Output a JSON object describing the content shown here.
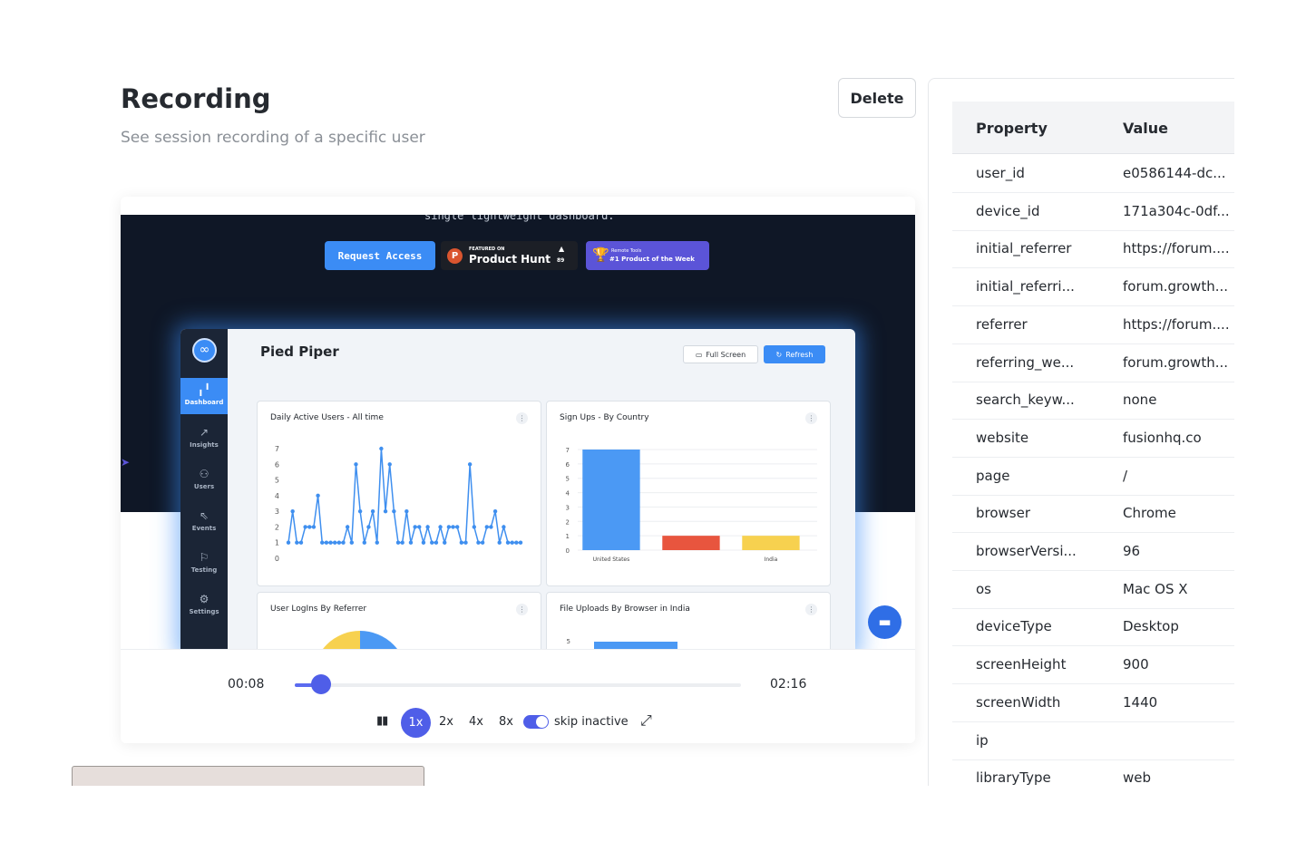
{
  "header": {
    "title": "Recording",
    "subtitle": "See session recording of a specific user",
    "delete_label": "Delete"
  },
  "recording": {
    "hero_text": "single lightweight dashboard.",
    "request_access_label": "Request Access",
    "product_hunt": {
      "featured": "FEATURED ON",
      "name": "Product Hunt",
      "upvotes": "89"
    },
    "remote_tools": {
      "small": "Remote Tools",
      "big": "#1 Product of the Week"
    },
    "dashboard": {
      "title": "Pied Piper",
      "full_screen_label": "Full Screen",
      "refresh_label": "Refresh",
      "nav": [
        {
          "label": "Dashboard",
          "icon": "bar-chart-icon"
        },
        {
          "label": "Insights",
          "icon": "trend-icon"
        },
        {
          "label": "Users",
          "icon": "users-icon"
        },
        {
          "label": "Events",
          "icon": "cursor-icon"
        },
        {
          "label": "Testing",
          "icon": "flag-icon"
        },
        {
          "label": "Settings",
          "icon": "wrench-icon"
        }
      ],
      "widgets": {
        "dau_title": "Daily Active Users - All time",
        "signups_title": "Sign Ups - By Country",
        "logins_title": "User LogIns By Referrer",
        "uploads_title": "File Uploads By Browser in India"
      }
    }
  },
  "chart_data": [
    {
      "type": "line",
      "title": "Daily Active Users - All time",
      "yticks": [
        "0",
        "1",
        "2",
        "3",
        "4",
        "5",
        "6",
        "7"
      ],
      "ylim": [
        0,
        7
      ],
      "values": [
        1,
        3,
        1,
        1,
        2,
        2,
        2,
        4,
        1,
        1,
        1,
        1,
        1,
        1,
        2,
        1,
        6,
        3,
        1,
        2,
        3,
        1,
        7,
        3,
        6,
        3,
        1,
        1,
        3,
        1,
        2,
        2,
        1,
        2,
        1,
        1,
        2,
        1,
        2,
        2,
        2,
        1,
        1,
        6,
        2,
        1,
        1,
        2,
        2,
        3,
        1,
        2,
        1,
        1,
        1,
        1
      ]
    },
    {
      "type": "bar",
      "title": "Sign Ups - By Country",
      "categories": [
        "United States",
        "",
        "India"
      ],
      "tick_labels": [
        "United States",
        "India"
      ],
      "values": [
        7,
        1,
        1
      ],
      "colors": [
        "#4b99f4",
        "#e8553e",
        "#f7d14f"
      ],
      "yticks": [
        "0",
        "1",
        "2",
        "3",
        "4",
        "5",
        "6",
        "7"
      ],
      "ylim": [
        0,
        7
      ]
    },
    {
      "type": "pie",
      "title": "User LogIns By Referrer",
      "colors": [
        "#f7d14f",
        "#4b99f4"
      ]
    },
    {
      "type": "bar",
      "title": "File Uploads By Browser in India",
      "yticks": [
        "5"
      ],
      "colors": [
        "#4b99f4"
      ]
    }
  ],
  "player": {
    "current_time": "00:08",
    "total_time": "02:16",
    "progress": 0.059,
    "speeds": [
      "1x",
      "2x",
      "4x",
      "8x"
    ],
    "active_speed": "1x",
    "skip_inactive_label": "skip inactive",
    "skip_inactive": true,
    "accent_color": "#4f5ee8"
  },
  "properties": {
    "header": {
      "property": "Property",
      "value": "Value"
    },
    "rows": [
      {
        "key": "user_id",
        "value": "e0586144-dc..."
      },
      {
        "key": "device_id",
        "value": "171a304c-0df..."
      },
      {
        "key": "initial_referrer",
        "value": "https://forum...."
      },
      {
        "key": "initial_referri...",
        "value": "forum.growth..."
      },
      {
        "key": "referrer",
        "value": "https://forum...."
      },
      {
        "key": "referring_we...",
        "value": "forum.growth..."
      },
      {
        "key": "search_keyw...",
        "value": "none"
      },
      {
        "key": "website",
        "value": "fusionhq.co"
      },
      {
        "key": "page",
        "value": "/"
      },
      {
        "key": "browser",
        "value": "Chrome"
      },
      {
        "key": "browserVersi...",
        "value": "96"
      },
      {
        "key": "os",
        "value": "Mac OS X"
      },
      {
        "key": "deviceType",
        "value": "Desktop"
      },
      {
        "key": "screenHeight",
        "value": "900"
      },
      {
        "key": "screenWidth",
        "value": "1440"
      },
      {
        "key": "ip",
        "value": ""
      },
      {
        "key": "libraryType",
        "value": "web"
      }
    ]
  }
}
